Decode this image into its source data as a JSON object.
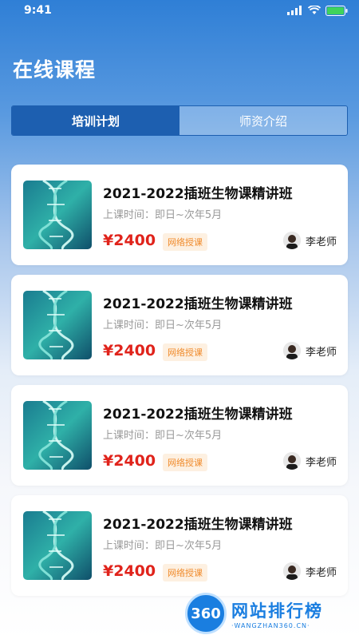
{
  "status_bar": {
    "time": "9:41"
  },
  "page": {
    "title": "在线课程"
  },
  "tabs": [
    {
      "label": "培训计划",
      "active": true
    },
    {
      "label": "师资介绍",
      "active": false
    }
  ],
  "courses": [
    {
      "title": "2021-2022插班生物课精讲班",
      "time": "上课时间：即日~次年5月",
      "price": "¥2400",
      "mode": "网络授课",
      "teacher": "李老师"
    },
    {
      "title": "2021-2022插班生物课精讲班",
      "time": "上课时间：即日~次年5月",
      "price": "¥2400",
      "mode": "网络授课",
      "teacher": "李老师"
    },
    {
      "title": "2021-2022插班生物课精讲班",
      "time": "上课时间：即日~次年5月",
      "price": "¥2400",
      "mode": "网络授课",
      "teacher": "李老师"
    },
    {
      "title": "2021-2022插班生物课精讲班",
      "time": "上课时间：即日~次年5月",
      "price": "¥2400",
      "mode": "网络授课",
      "teacher": "李老师"
    }
  ],
  "watermark": {
    "logo": "360",
    "title": "网站排行榜",
    "subtitle": "·WANGZHAN360.CN·"
  },
  "colors": {
    "primary": "#1d5fb0",
    "price": "#e0231b",
    "tag": "#f08a2a"
  }
}
